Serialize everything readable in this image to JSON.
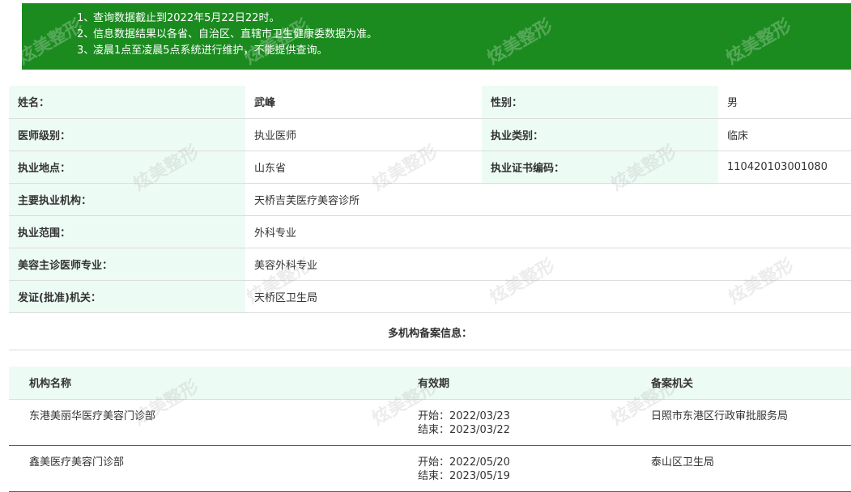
{
  "notice": {
    "items": [
      {
        "num": "1、",
        "text": "查询数据截止到2022年5月22日22时。"
      },
      {
        "num": "2、",
        "text": "信息数据结果以各省、自治区、直辖市卫生健康委数据为准。"
      },
      {
        "num": "3、",
        "text": "凌晨1点至凌晨5点系统进行维护，不能提供查询。"
      }
    ]
  },
  "doctor": {
    "name_label": "姓名：",
    "name": "武峰",
    "gender_label": "性别：",
    "gender": "男",
    "level_label": "医师级别：",
    "level": "执业医师",
    "category_label": "执业类别：",
    "category": "临床",
    "location_label": "执业地点：",
    "location": "山东省",
    "cert_label": "执业证书编码：",
    "cert": "110420103001080",
    "institution_label": "主要执业机构：",
    "institution": "天桥吉芙医疗美容诊所",
    "scope_label": "执业范围：",
    "scope": "外科专业",
    "specialty_label": "美容主诊医师专业：",
    "specialty": "美容外科专业",
    "issuer_label": "发证(批准)机关：",
    "issuer": "天桥区卫生局"
  },
  "multi_org": {
    "title": "多机构备案信息：",
    "headers": {
      "name": "机构名称",
      "validity": "有效期",
      "authority": "备案机关"
    },
    "rows": [
      {
        "name": "东港美丽华医疗美容门诊部",
        "start": "开始：2022/03/23",
        "end": "结束：2023/03/22",
        "authority": "日照市东港区行政审批服务局"
      },
      {
        "name": "鑫美医疗美容门诊部",
        "start": "开始：2022/05/20",
        "end": "结束：2023/05/19",
        "authority": "泰山区卫生局"
      }
    ]
  },
  "watermark": {
    "text": "炫美整形"
  },
  "colors": {
    "banner_green": "#1b8b1f",
    "label_bg": "#edfbf5",
    "row_border": "#dcdcdc"
  }
}
